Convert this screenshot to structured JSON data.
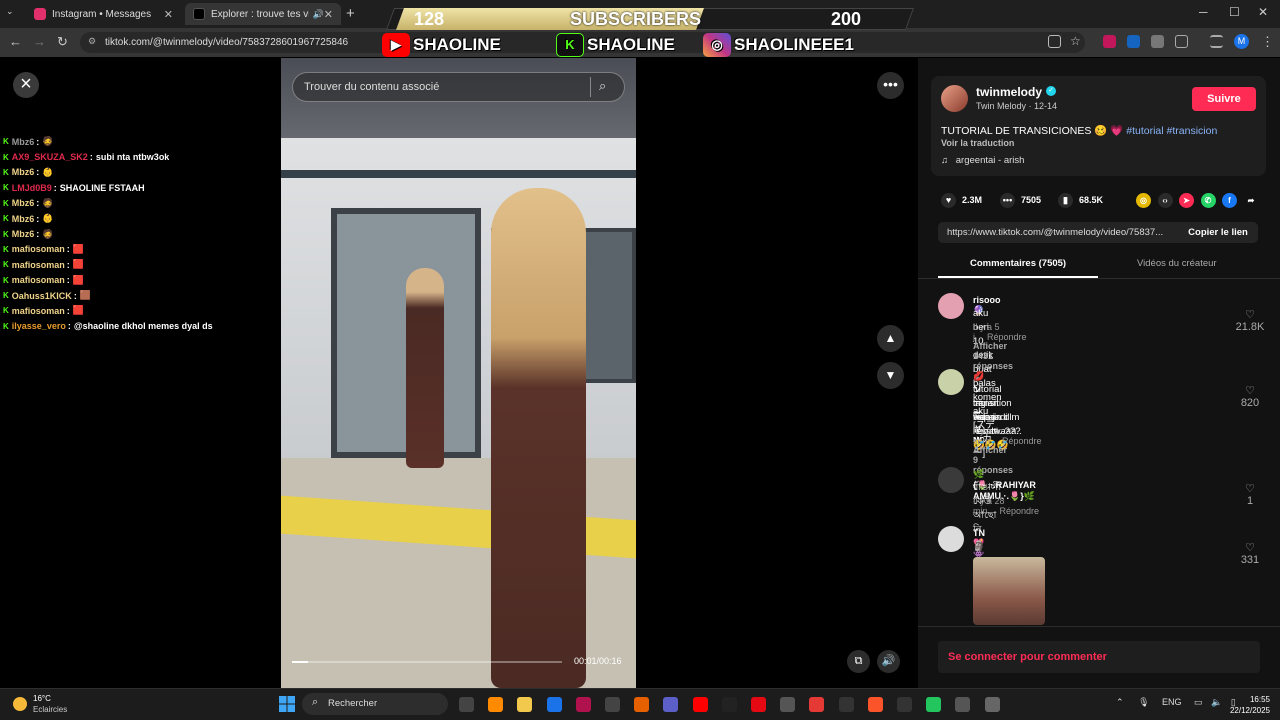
{
  "browser": {
    "tabs": [
      {
        "title": "Instagram • Messages",
        "favicon_color": "#e1306c"
      },
      {
        "title": "Explorer : trouve tes vidéos",
        "favicon_color": "#000000"
      }
    ],
    "new_tab": "+",
    "url": "tiktok.com/@twinmelody/video/7583728601967725846",
    "window_controls": {
      "minimize": "─",
      "maximize": "☐",
      "close": "✕"
    },
    "profile_initial": "M"
  },
  "overlay": {
    "count_left": "128",
    "label": "SUBSCRIBERS",
    "count_right": "200",
    "socials": [
      {
        "handle": "SHAOLINE",
        "icon": "youtube-icon",
        "color": "#ff0000"
      },
      {
        "handle": "SHAOLINE",
        "icon": "kick-icon",
        "color": "#53fc18"
      },
      {
        "handle": "SHAOLINEEE1",
        "icon": "instagram-icon",
        "color": "#c13584"
      }
    ]
  },
  "chat": {
    "messages": [
      {
        "user": "Mbz6",
        "user_color": "#9a9a9a",
        "text": "🧔"
      },
      {
        "user": "AX9_SKUZA_SK2",
        "user_color": "#e02a4d",
        "text": "subi nta ntbw3ok"
      },
      {
        "user": "Mbz6",
        "user_color": "#f1d48b",
        "text": "👶"
      },
      {
        "user": "LMJd0B9",
        "user_color": "#e02a4d",
        "text": "SHAOLINE FSTAAH"
      },
      {
        "user": "Mbz6",
        "user_color": "#f1d48b",
        "text": "🧔"
      },
      {
        "user": "Mbz6",
        "user_color": "#f1d48b",
        "text": "👶"
      },
      {
        "user": "Mbz6",
        "user_color": "#f1d48b",
        "text": "🧔"
      },
      {
        "user": "mafiosoman",
        "user_color": "#f1d48b",
        "text": "🟥"
      },
      {
        "user": "mafiosoman",
        "user_color": "#f1d48b",
        "text": "🟥"
      },
      {
        "user": "mafiosoman",
        "user_color": "#f1d48b",
        "text": "🟥"
      },
      {
        "user": "Oahuss1KICK",
        "user_color": "#f1d48b",
        "text": "🟫"
      },
      {
        "user": "mafiosoman",
        "user_color": "#f1d48b",
        "text": "🟥"
      },
      {
        "user": "ilyasse_vero",
        "user_color": "#e89b2c",
        "text": "@shaoline dkhol memes dyal ds"
      }
    ]
  },
  "video": {
    "search_placeholder": "Trouver du contenu associé",
    "time": "00:01/00:16",
    "progress_fraction": 0.06
  },
  "panel": {
    "username": "twinmelody",
    "display_name_date": "Twin Melody · 12-14",
    "follow_label": "Suivre",
    "caption_text": "TUTORIAL DE TRANSICIONES 🥴 💗",
    "caption_tags": "#tutorial #transicion",
    "translate_label": "Voir la traduction",
    "music": "argeentai - arish",
    "stats": {
      "likes": "2.3M",
      "comments": "7505",
      "saves": "68.5K"
    },
    "share_icons": [
      {
        "name": "coin-icon",
        "color": "#e6b800",
        "glyph": "◎"
      },
      {
        "name": "embed-icon",
        "color": "#2a2a2a",
        "glyph": "‹›"
      },
      {
        "name": "send-icon",
        "color": "#fe2c55",
        "glyph": "➤"
      },
      {
        "name": "whatsapp-icon",
        "color": "#25d366",
        "glyph": "✆"
      },
      {
        "name": "facebook-icon",
        "color": "#1877f2",
        "glyph": "f"
      },
      {
        "name": "share-arrow-icon",
        "color": "#121212",
        "glyph": "➦"
      }
    ],
    "link": "https://www.tiktok.com/@twinmelody/video/75837...",
    "copy_label": "Copier le lien",
    "tabs": [
      "Commentaires (7505)",
      "Vidéos du créateur"
    ],
    "comments": [
      {
        "user": "risooo🔮",
        "text": [
          "aku beri 10 detik buat balas komen aku [ステッカー]"
        ],
        "time": "Il y a 5 j",
        "reply": "Répondre",
        "replies": "Afficher 1431 réponses ⌄",
        "likes": "21.8K",
        "avatar": "#e3a0b0"
      },
      {
        "user": "💋 ソーニャ ᴍᴄ",
        "text": [
          "tutorial transition video result",
          "lagian napain dlm kereta..??? 🥹🥹🥹",
          "'kan jadi kebawaaa.. 🤣🤣🤣"
        ],
        "time": "Il y a 1 sem",
        "reply": "Répondre",
        "replies": "Afficher 9 réponses ⌄",
        "likes": "820",
        "avatar": "#c9d1a8"
      },
      {
        "user": "🌿 {🌷.·.RAHIYAR AMMU.·.🌷}🌿",
        "text": [
          "বাঙালী কেউ আছো নি"
        ],
        "time": "Il y a 28 min",
        "reply": "Répondre",
        "replies": "",
        "likes": "1",
        "avatar": "#3a3a3a"
      },
      {
        "user": "TN💖👾",
        "text": [
          "🗿"
        ],
        "time": "",
        "reply": "",
        "replies": "",
        "likes": "331",
        "avatar": "#dcdcdc"
      }
    ],
    "login_label": "Se connecter pour commenter"
  },
  "taskbar": {
    "weather_temp": "16°C",
    "weather_desc": "Eclaircies",
    "search_label": "Rechercher",
    "tray_lang": "ENG",
    "time": "16:55",
    "date": "22/12/2025"
  }
}
